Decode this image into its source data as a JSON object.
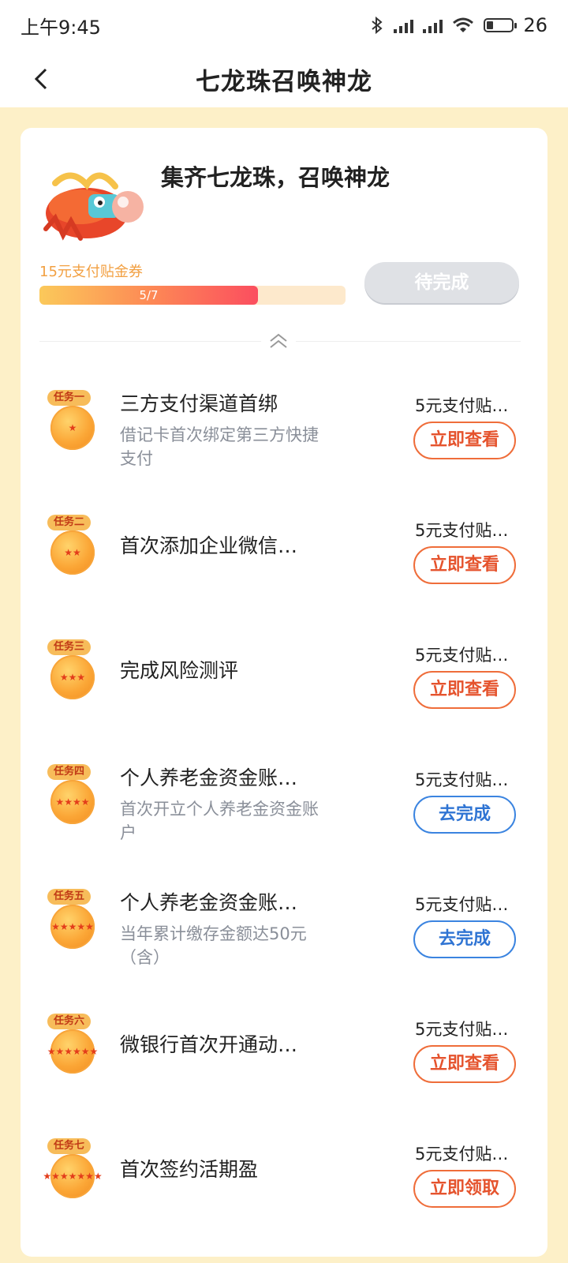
{
  "status": {
    "time": "上午9:45",
    "battery": "26"
  },
  "nav": {
    "title": "七龙珠召唤神龙"
  },
  "card": {
    "title": "集齐七龙珠，召唤神龙",
    "reward_label": "15元支付贴金券",
    "progress_text": "5/7",
    "progress_fraction": 0.714,
    "pending_button": "待完成"
  },
  "tasks": [
    {
      "badge": "任务一",
      "title": "三方支付渠道首绑",
      "desc": "借记卡首次绑定第三方快捷支付",
      "reward": "5元支付贴…",
      "button": "立即查看",
      "style": "orange",
      "stars": "★"
    },
    {
      "badge": "任务二",
      "title": "首次添加企业微信…",
      "desc": "",
      "reward": "5元支付贴…",
      "button": "立即查看",
      "style": "orange",
      "stars": "★★"
    },
    {
      "badge": "任务三",
      "title": "完成风险测评",
      "desc": "",
      "reward": "5元支付贴…",
      "button": "立即查看",
      "style": "orange",
      "stars": "★★★"
    },
    {
      "badge": "任务四",
      "title": "个人养老金资金账…",
      "desc": "首次开立个人养老金资金账户",
      "reward": "5元支付贴…",
      "button": "去完成",
      "style": "blue",
      "stars": "★★★★"
    },
    {
      "badge": "任务五",
      "title": "个人养老金资金账…",
      "desc": "当年累计缴存金额达50元（含）",
      "reward": "5元支付贴…",
      "button": "去完成",
      "style": "blue",
      "stars": "★★★★★"
    },
    {
      "badge": "任务六",
      "title": "微银行首次开通动…",
      "desc": "",
      "reward": "5元支付贴…",
      "button": "立即查看",
      "style": "orange",
      "stars": "★★★★★★"
    },
    {
      "badge": "任务七",
      "title": "首次签约活期盈",
      "desc": "",
      "reward": "5元支付贴…",
      "button": "立即领取",
      "style": "orange",
      "stars": "★★★★★★★"
    }
  ],
  "colors": {
    "accent_orange": "#e5532d",
    "accent_blue": "#2f74d3",
    "page_bg": "#fdf0c8"
  }
}
